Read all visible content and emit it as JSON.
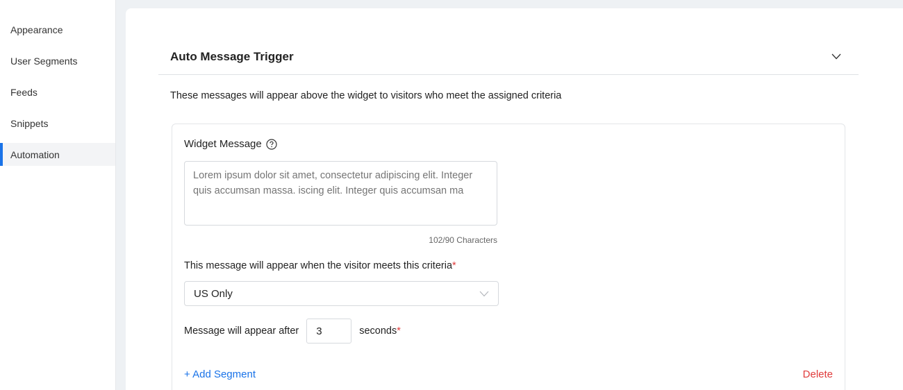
{
  "sidebar": {
    "items": [
      {
        "label": "Appearance",
        "active": false
      },
      {
        "label": "User Segments",
        "active": false
      },
      {
        "label": "Feeds",
        "active": false
      },
      {
        "label": "Snippets",
        "active": false
      },
      {
        "label": "Automation",
        "active": true
      }
    ]
  },
  "section": {
    "title": "Auto Message Trigger",
    "description": "These messages will appear above the widget to visitors who meet the assigned criteria"
  },
  "card": {
    "widget_message_label": "Widget Message",
    "widget_message_placeholder": "Lorem ipsum dolor sit amet, consectetur adipiscing elit. Integer quis accumsan massa. iscing elit. Integer quis accumsan ma",
    "char_count": "102/90 Characters",
    "criteria_label": "This message will appear when the visitor meets this criteria",
    "required_mark": "*",
    "criteria_selected": "US Only",
    "delay_prefix": "Message will appear after",
    "delay_value": "3",
    "delay_suffix": "seconds",
    "add_segment_label": "+ Add Segment",
    "delete_label": "Delete"
  },
  "colors": {
    "accent": "#1a73e8",
    "danger": "#e03b3b",
    "page_bg": "#eef1f4"
  },
  "icons": {
    "collapse": "chevron-down-icon",
    "help": "question-circle-icon",
    "select": "chevron-down-icon"
  }
}
